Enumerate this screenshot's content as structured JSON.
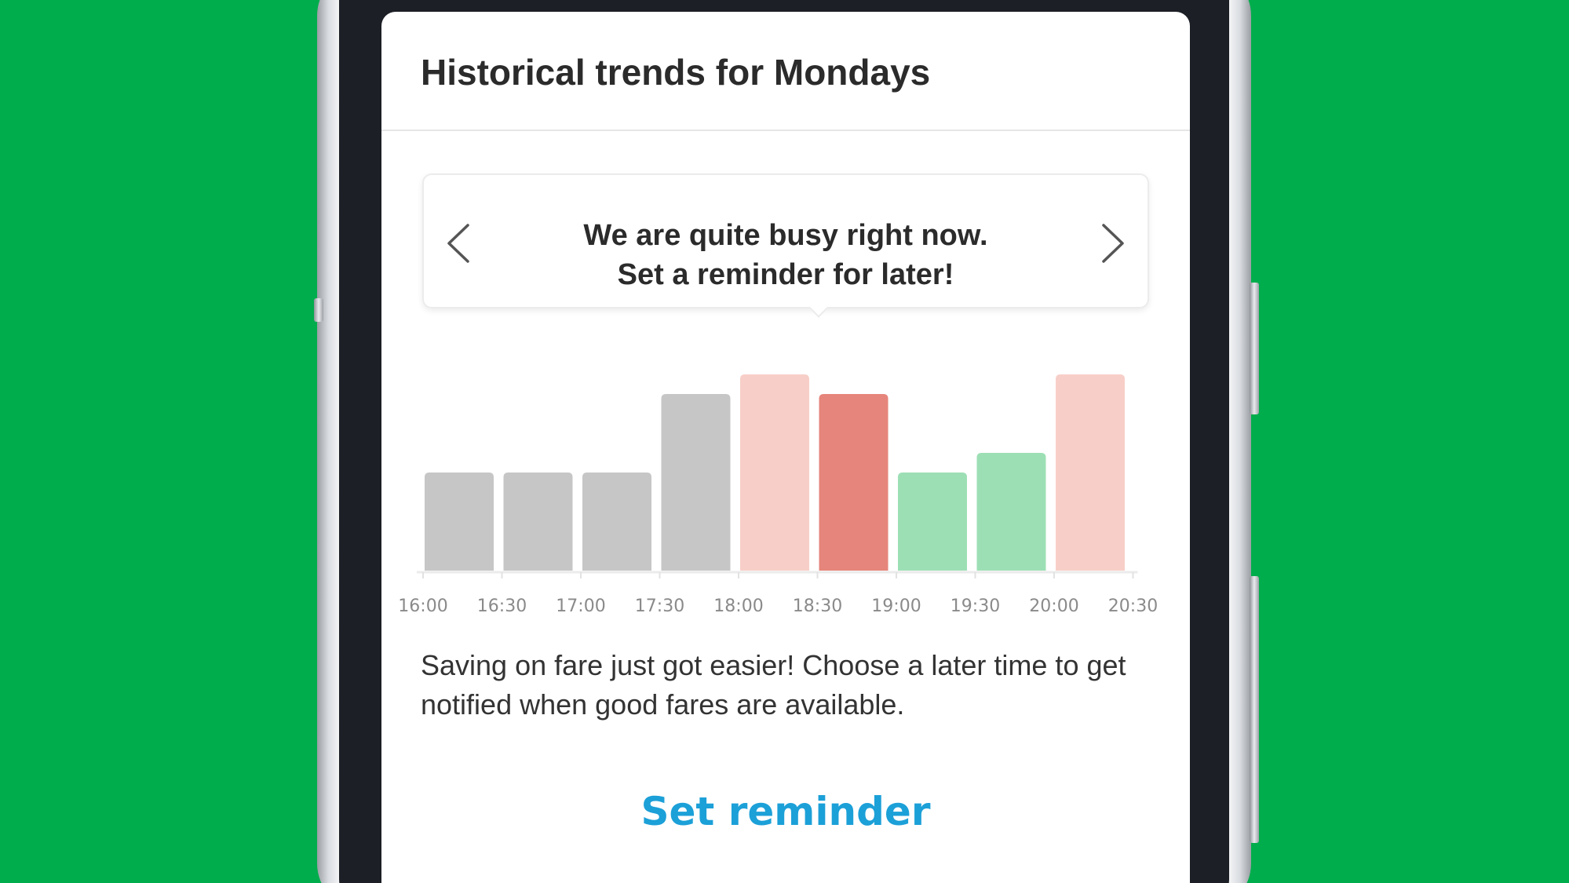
{
  "card": {
    "title": "Historical trends for Mondays",
    "tooltip": {
      "line1": "We are quite busy right now.",
      "line2": "Set a reminder for later!",
      "prev_icon": "chevron-left-icon",
      "next_icon": "chevron-right-icon"
    },
    "description": "Saving on fare just got easier! Choose a later time to get notified when good fares are available.",
    "action_label": "Set reminder",
    "action_color": "#1ca0d8"
  },
  "chart_data": {
    "type": "bar",
    "categories": [
      "16:00",
      "16:30",
      "17:00",
      "17:30",
      "18:00",
      "18:30",
      "19:00",
      "19:30",
      "20:00",
      "20:30"
    ],
    "bars": [
      {
        "value": 5,
        "color": "#c6c6c6"
      },
      {
        "value": 5,
        "color": "#c6c6c6"
      },
      {
        "value": 5,
        "color": "#c6c6c6"
      },
      {
        "value": 9,
        "color": "#c6c6c6"
      },
      {
        "value": 10,
        "color": "#f7cfc8"
      },
      {
        "value": 9,
        "color": "#e6857b"
      },
      {
        "value": 5,
        "color": "#9ddfb5"
      },
      {
        "value": 6,
        "color": "#9ddfb5"
      },
      {
        "value": 10,
        "color": "#f7cfc8"
      }
    ],
    "ylim": [
      0,
      10
    ],
    "grid": false,
    "legend": "none",
    "highlight_category": "18:30"
  }
}
